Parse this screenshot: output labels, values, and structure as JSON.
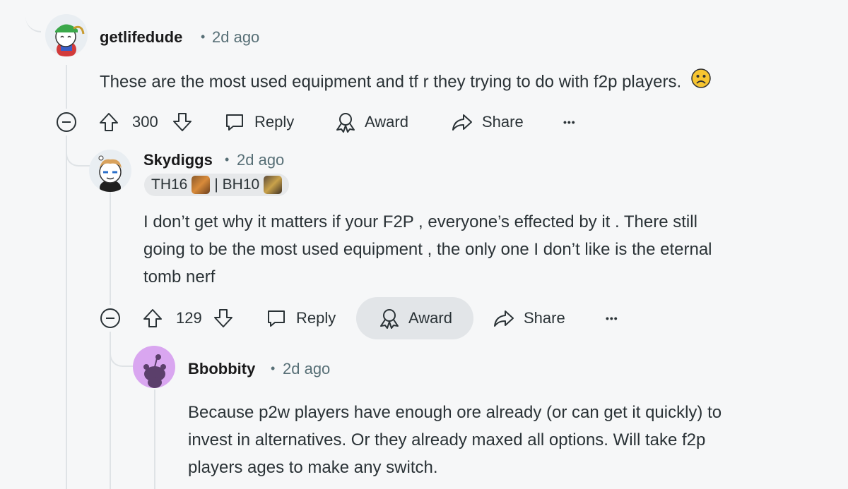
{
  "comments": [
    {
      "username": "getlifedude",
      "time": "2d ago",
      "text": "These are the most used equipment and tf r they trying to do with f2p players.",
      "emoji": "😟",
      "votes": "300",
      "actions": {
        "reply": "Reply",
        "award": "Award",
        "share": "Share",
        "more": "•••"
      }
    },
    {
      "username": "Skydiggs",
      "time": "2d ago",
      "flair": {
        "th": "TH16",
        "bh": "| BH10"
      },
      "text_lines": [
        "I don’t get why it matters if your F2P , everyone’s effected by it . There still",
        "going to be the most used equipment , the only one I don’t like is the eternal",
        "tomb nerf"
      ],
      "votes": "129",
      "actions": {
        "reply": "Reply",
        "award": "Award",
        "share": "Share",
        "more": "•••"
      }
    },
    {
      "username": "Bbobbity",
      "time": "2d ago",
      "text_lines": [
        "Because p2w players have enough ore already (or can get it quickly) to",
        "invest in alternatives. Or they already maxed all options. Will take f2p",
        "players ages to make any switch."
      ]
    }
  ],
  "colors": {
    "background": "#f6f7f8",
    "thread_line": "#dfe3e6",
    "award_hover_bg": "#e2e5e8",
    "bbobbity_avatar_bg": "#d9a6f0"
  }
}
